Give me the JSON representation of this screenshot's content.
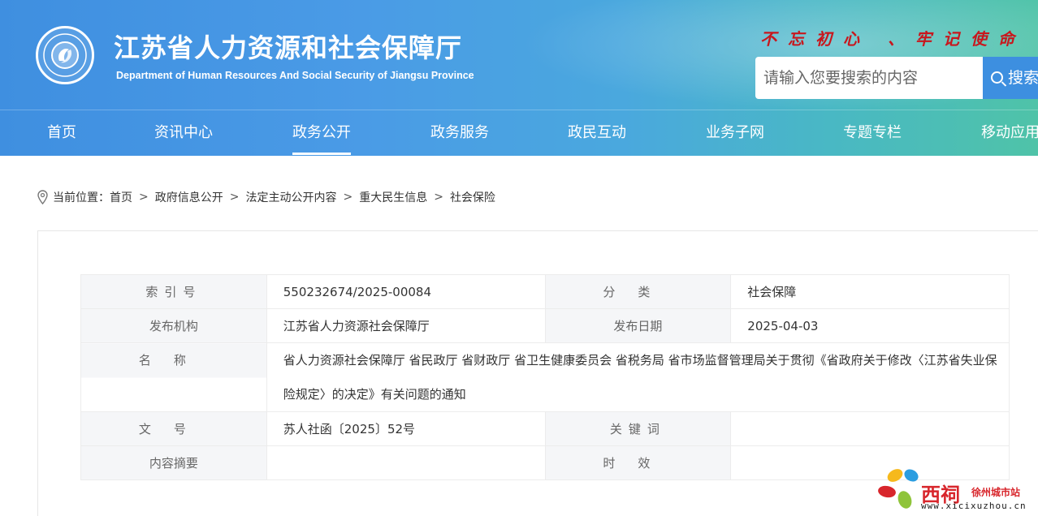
{
  "header": {
    "title": "江苏省人力资源和社会保障厅",
    "subtitle": "Department of Human Resources And Social Security of Jiangsu Province",
    "slogan": "不忘初心 、牢记使命",
    "logo_icon": "department-emblem-icon",
    "search": {
      "placeholder": "请输入您要搜索的内容",
      "button_label": "搜索",
      "button_icon": "search-icon"
    },
    "colors": {
      "gradient_start": "#3f8fe0",
      "gradient_end": "#4fc3a8",
      "slogan": "#c8171d"
    }
  },
  "nav": {
    "items": [
      {
        "label": "首页"
      },
      {
        "label": "资讯中心"
      },
      {
        "label": "政务公开",
        "active": true
      },
      {
        "label": "政务服务"
      },
      {
        "label": "政民互动"
      },
      {
        "label": "业务子网"
      },
      {
        "label": "专题专栏"
      },
      {
        "label": "移动应用"
      }
    ]
  },
  "breadcrumb": {
    "prefix": "当前位置：",
    "items": [
      "首页",
      "政府信息公开",
      "法定主动公开内容",
      "重大民生信息",
      "社会保险"
    ],
    "separator": ">"
  },
  "meta": {
    "index_label": "索引号",
    "index_value": "550232674/2025-00084",
    "category_label": "分类",
    "category_value": "社会保障",
    "publisher_label": "发布机构",
    "publisher_value": "江苏省人力资源社会保障厅",
    "date_label": "发布日期",
    "date_value": "2025-04-03",
    "name_label": "名称",
    "name_value": "省人力资源社会保障厅 省民政厅 省财政厅 省卫生健康委员会 省税务局 省市场监督管理局关于贯彻《省政府关于修改〈江苏省失业保险规定〉的决定》有关问题的通知",
    "docno_label": "文号",
    "docno_value": "苏人社函〔2025〕52号",
    "keywords_label": "关键词",
    "keywords_value": "",
    "summary_label": "内容摘要",
    "summary_value": "",
    "validity_label": "时效",
    "validity_value": ""
  },
  "watermark": {
    "brand": "西祠",
    "tagline": "徐州城市站",
    "url": "www.xicixuzhou.cn"
  }
}
